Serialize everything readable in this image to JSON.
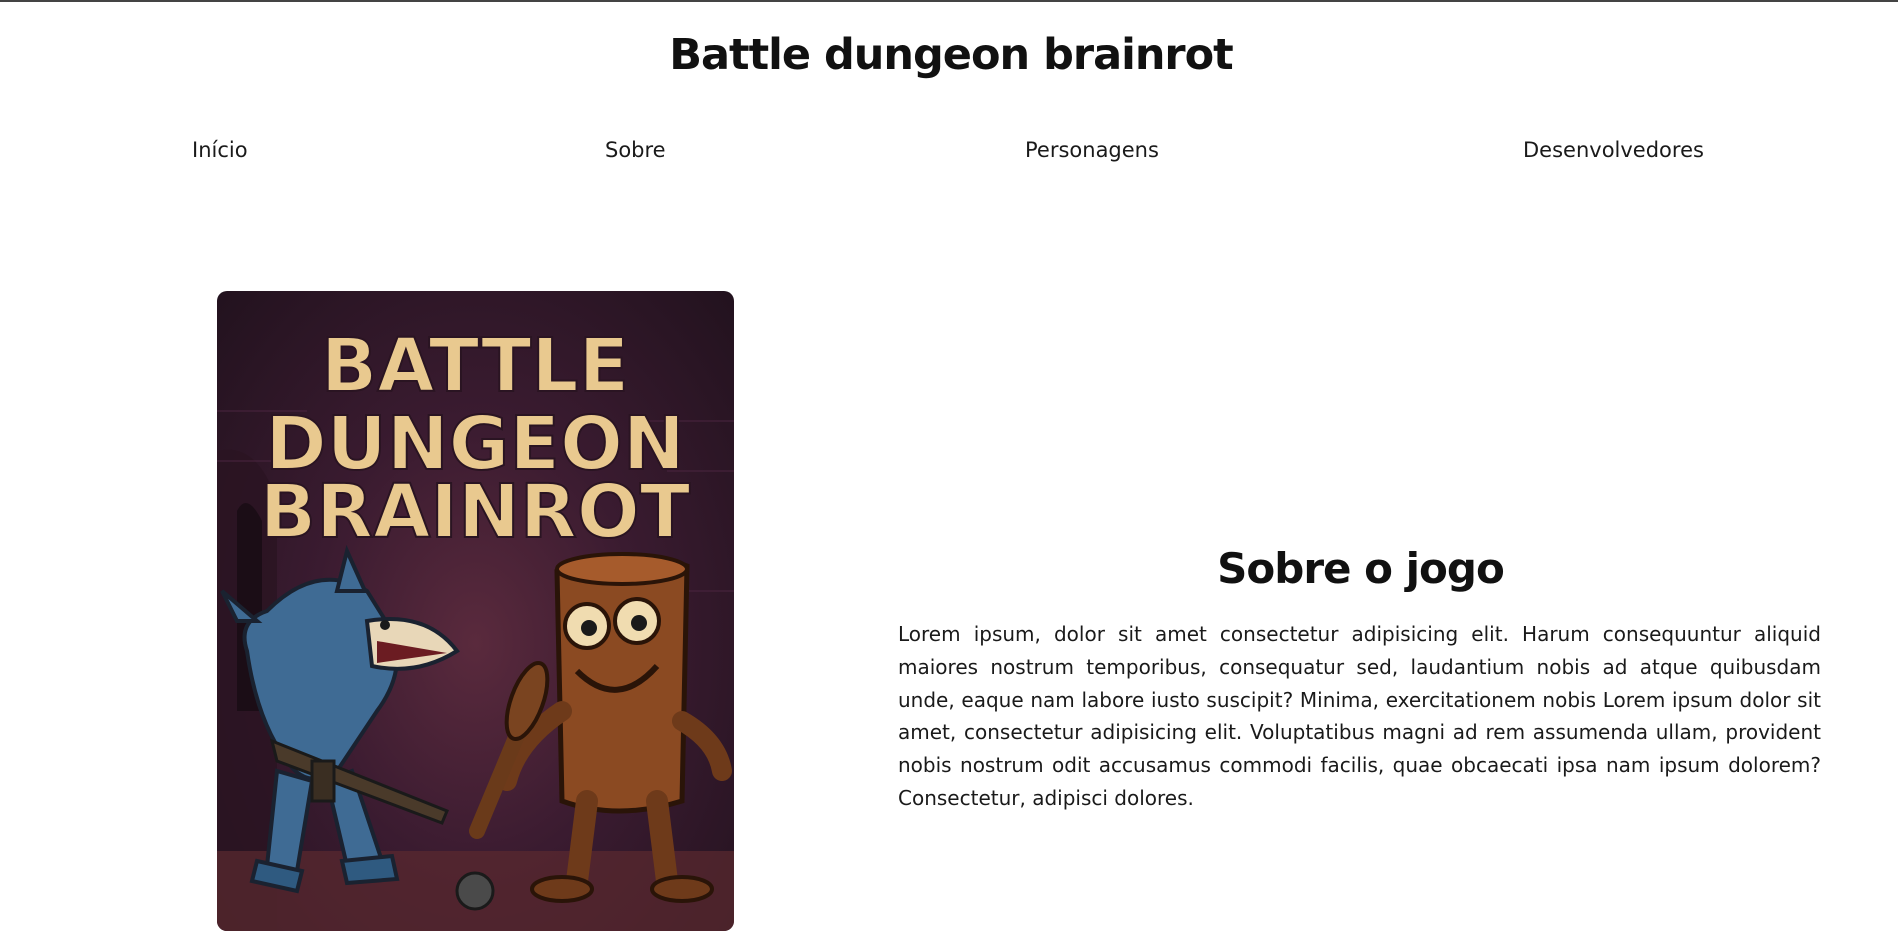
{
  "site": {
    "title": "Battle dungeon brainrot"
  },
  "nav": {
    "items": [
      {
        "label": "Início"
      },
      {
        "label": "Sobre"
      },
      {
        "label": "Personagens"
      },
      {
        "label": "Desenvolvedores"
      }
    ]
  },
  "poster": {
    "title_lines": [
      "BATTLE",
      "DUNGEON",
      "BRAINROT"
    ],
    "colors": {
      "title": "#e9c98f",
      "background": "#3a1b30",
      "shark": "#3f6b94",
      "log": "#8b4a22"
    }
  },
  "about": {
    "title": "Sobre o jogo",
    "text": "Lorem ipsum, dolor sit amet consectetur adipisicing elit. Harum consequuntur aliquid maiores nostrum temporibus, consequatur sed, laudantium nobis ad atque quibusdam unde, eaque nam labore iusto suscipit? Minima, exercitationem nobis Lorem ipsum dolor sit amet, consectetur adipisicing elit. Voluptatibus magni ad rem assumenda ullam, provident nobis nostrum odit accusamus commodi facilis, quae obcaecati ipsa nam ipsum dolorem? Consectetur, adipisci dolores."
  }
}
